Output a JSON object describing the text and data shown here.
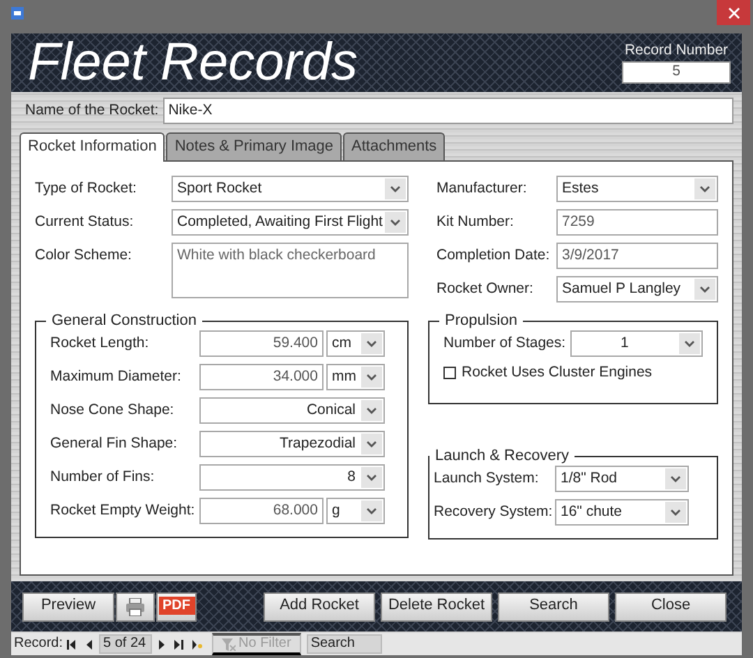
{
  "header": {
    "title": "Fleet Records",
    "record_number_label": "Record Number",
    "record_number": "5"
  },
  "rocket_name": {
    "label": "Name of the Rocket:",
    "value": "Nike-X"
  },
  "tabs": [
    {
      "label": "Rocket Information",
      "selected": true
    },
    {
      "label": "Notes & Primary Image",
      "selected": false
    },
    {
      "label": "Attachments",
      "selected": false
    }
  ],
  "left_fields": [
    {
      "label": "Type of Rocket:",
      "value": "Sport Rocket",
      "kind": "combo"
    },
    {
      "label": "Current Status:",
      "value": "Completed, Awaiting First Flight",
      "kind": "combo"
    },
    {
      "label": "Color Scheme:",
      "value": "White with black checkerboard",
      "kind": "memo"
    }
  ],
  "right_fields": [
    {
      "label": "Manufacturer:",
      "value": "Estes",
      "kind": "combo"
    },
    {
      "label": "Kit Number:",
      "value": "7259",
      "kind": "text"
    },
    {
      "label": "Completion Date:",
      "value": "3/9/2017",
      "kind": "text"
    },
    {
      "label": "Rocket Owner:",
      "value": "Samuel P Langley",
      "kind": "combo"
    }
  ],
  "general_construction": {
    "title": "General Construction",
    "fields": [
      {
        "label": "Rocket Length:",
        "value": "59.400",
        "unit": "cm",
        "kind": "measure"
      },
      {
        "label": "Maximum Diameter:",
        "value": "34.000",
        "unit": "mm",
        "kind": "measure"
      },
      {
        "label": "Nose Cone Shape:",
        "value": "Conical",
        "kind": "right_combo"
      },
      {
        "label": "General Fin Shape:",
        "value": "Trapezodial",
        "kind": "right_combo"
      },
      {
        "label": "Number of Fins:",
        "value": "8",
        "kind": "right_combo"
      },
      {
        "label": "Rocket Empty Weight:",
        "value": "68.000",
        "unit": "g",
        "kind": "measure"
      }
    ]
  },
  "propulsion": {
    "title": "Propulsion",
    "fields": [
      {
        "label": "Number of Stages:",
        "value": "1",
        "kind": "center_combo"
      }
    ],
    "checkbox": {
      "label": "Rocket Uses Cluster Engines",
      "checked": false
    }
  },
  "launch_recovery": {
    "title": "Launch & Recovery",
    "fields": [
      {
        "label": "Launch System:",
        "value": "1/8\" Rod",
        "kind": "combo"
      },
      {
        "label": "Recovery System:",
        "value": "16\" chute",
        "kind": "combo"
      }
    ]
  },
  "buttons": [
    {
      "label": "Preview",
      "kind": "text"
    },
    {
      "kind": "print"
    },
    {
      "label": "PDF",
      "kind": "pdf"
    },
    {
      "label": "Add Rocket",
      "kind": "text"
    },
    {
      "label": "Delete Rocket",
      "kind": "text"
    },
    {
      "label": "Search",
      "kind": "text"
    },
    {
      "label": "Close",
      "kind": "text"
    }
  ],
  "navigation": {
    "label": "Record:",
    "position": "5 of 24",
    "filter": {
      "label": "No Filter",
      "disabled": true
    },
    "search": "Search"
  }
}
